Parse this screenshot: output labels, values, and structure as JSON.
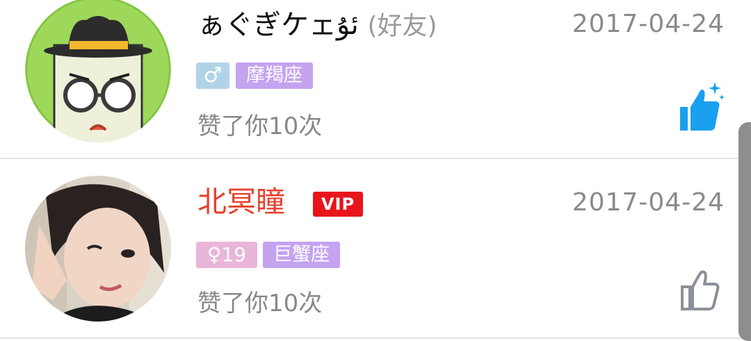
{
  "rows": [
    {
      "name": "ぁぐぎケェئۇ",
      "friend_tag": "(好友)",
      "date": "2017-04-24",
      "gender_symbol": "♂",
      "zodiac": "摩羯座",
      "action": "赞了你10次",
      "gender_color": "#b1d3e8",
      "zodiac_color": "#c4a3f0",
      "liked": true,
      "avatar": "cartoon-hat-glasses-avatar"
    },
    {
      "name": "北冥瞳",
      "vip_label": "VIP",
      "date": "2017-04-24",
      "gender_symbol": "♀",
      "age": "19",
      "zodiac": "巨蟹座",
      "action": "赞了你10次",
      "name_color": "#e8412e",
      "gender_color": "#e9b6da",
      "zodiac_color": "#c4a3f0",
      "liked": false,
      "avatar": "selfie-photo-avatar"
    }
  ],
  "colors": {
    "like_active": "#19a0f0",
    "like_inactive": "#8b8f99",
    "vip": "#e8141b"
  }
}
